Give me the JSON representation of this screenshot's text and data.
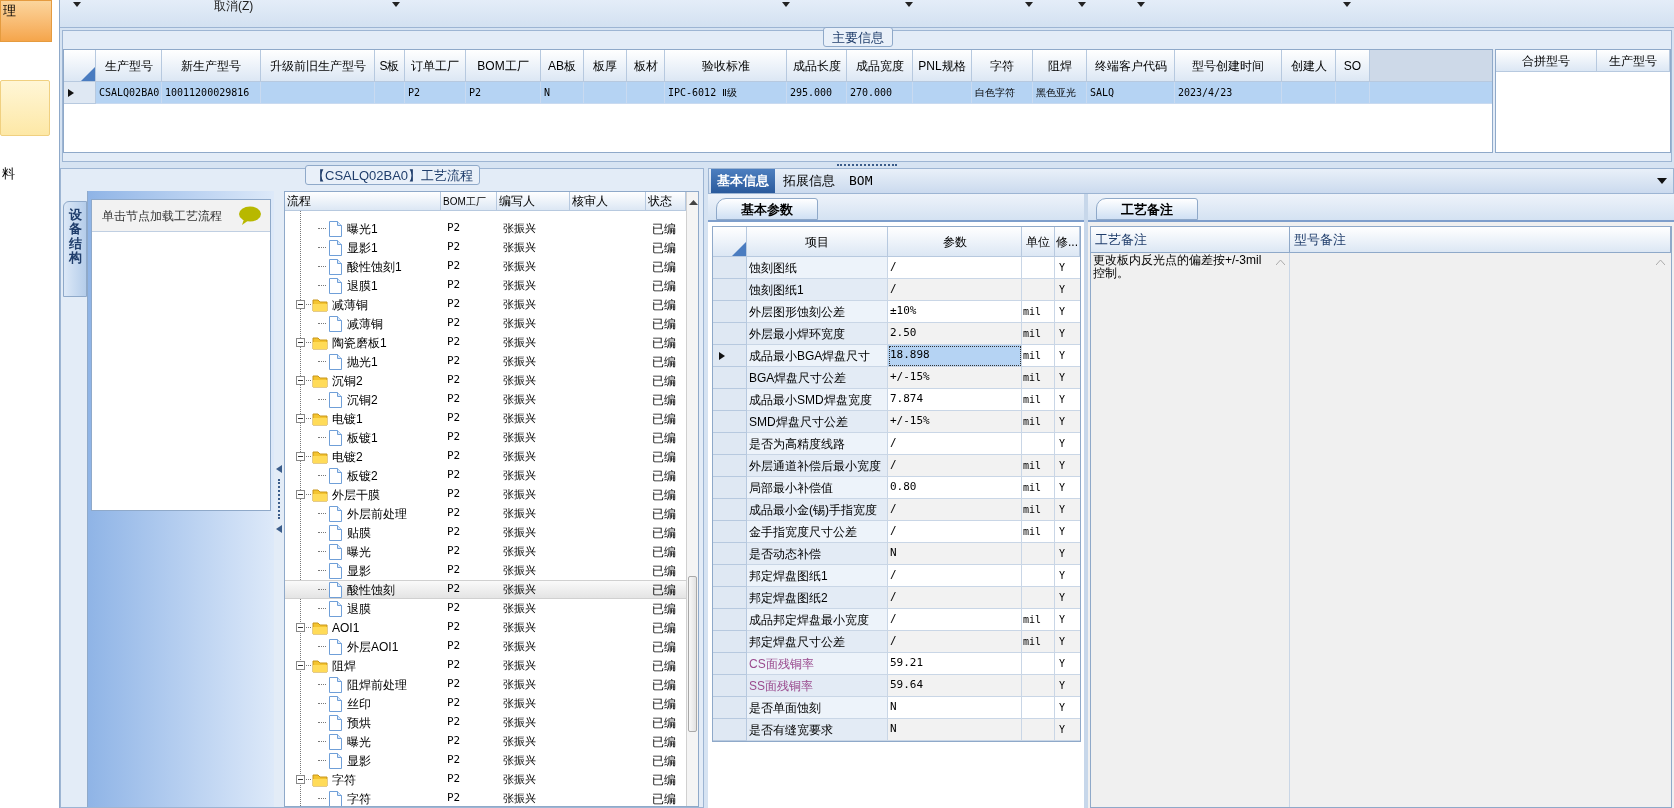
{
  "left_nav": [
    {
      "label": "理",
      "selected": true
    },
    {
      "label": "料",
      "selected": false
    }
  ],
  "toolbar": {
    "label": "取消(Z)"
  },
  "main_info": {
    "title": "主要信息",
    "columns": [
      "生产型号",
      "新生产型号",
      "升级前旧生产型号",
      "S板",
      "订单工厂",
      "BOM工厂",
      "AB板",
      "板厚",
      "板材",
      "验收标准",
      "成品长度",
      "成品宽度",
      "PNL规格",
      "字符",
      "阻焊",
      "终端客户代码",
      "型号创建时间",
      "创建人",
      "SO"
    ],
    "rows": [
      {
        "selected": true,
        "cells": [
          "CSALQ02BA0",
          "10011200029816",
          null,
          null,
          "P2",
          "P2",
          "N",
          null,
          null,
          "IPC-6012 Ⅱ级",
          "295.000",
          "270.000",
          null,
          "白色字符",
          "黑色亚光",
          "SALQ",
          "2023/4/23",
          null,
          null
        ]
      }
    ],
    "merge_columns": [
      "合拼型号",
      "生产型号"
    ]
  },
  "process": {
    "title": "【CSALQ02BA0】工艺流程",
    "side_tab": "设备结构",
    "hint": "单击节点加载工艺流程",
    "columns": [
      "流程",
      "BOM工厂",
      "编写人",
      "核审人",
      "状态"
    ],
    "nodes": [
      {
        "children": [
          {
            "name": "曝光1",
            "bom_factory": "P2",
            "writer": "张振兴",
            "status": "已编",
            "selected": false
          },
          {
            "name": "显影1",
            "bom_factory": "P2",
            "writer": "张振兴",
            "status": "已编",
            "selected": false
          },
          {
            "name": "酸性蚀刻1",
            "bom_factory": "P2",
            "writer": "张振兴",
            "status": "已编",
            "selected": false
          },
          {
            "name": "退膜1",
            "bom_factory": "P2",
            "writer": "张振兴",
            "status": "已编",
            "selected": false
          }
        ]
      },
      {
        "name": "减薄铜",
        "bom_factory": "P2",
        "writer": "张振兴",
        "status": "已编",
        "selected": false,
        "expanded": true,
        "children": [
          {
            "name": "减薄铜",
            "bom_factory": "P2",
            "writer": "张振兴",
            "status": "已编",
            "selected": false
          }
        ]
      },
      {
        "name": "陶瓷磨板1",
        "bom_factory": "P2",
        "writer": "张振兴",
        "status": "已编",
        "selected": false,
        "expanded": true,
        "children": [
          {
            "name": "抛光1",
            "bom_factory": "P2",
            "writer": "张振兴",
            "status": "已编",
            "selected": false
          }
        ]
      },
      {
        "name": "沉铜2",
        "bom_factory": "P2",
        "writer": "张振兴",
        "status": "已编",
        "selected": false,
        "expanded": true,
        "children": [
          {
            "name": "沉铜2",
            "bom_factory": "P2",
            "writer": "张振兴",
            "status": "已编",
            "selected": false
          }
        ]
      },
      {
        "name": "电镀1",
        "bom_factory": "P2",
        "writer": "张振兴",
        "status": "已编",
        "selected": false,
        "expanded": true,
        "children": [
          {
            "name": "板镀1",
            "bom_factory": "P2",
            "writer": "张振兴",
            "status": "已编",
            "selected": false
          }
        ]
      },
      {
        "name": "电镀2",
        "bom_factory": "P2",
        "writer": "张振兴",
        "status": "已编",
        "selected": false,
        "expanded": true,
        "children": [
          {
            "name": "板镀2",
            "bom_factory": "P2",
            "writer": "张振兴",
            "status": "已编",
            "selected": false
          }
        ]
      },
      {
        "name": "外层干膜",
        "bom_factory": "P2",
        "writer": "张振兴",
        "status": "已编",
        "selected": false,
        "expanded": true,
        "children": [
          {
            "name": "外层前处理",
            "bom_factory": "P2",
            "writer": "张振兴",
            "status": "已编",
            "selected": false
          },
          {
            "name": "贴膜",
            "bom_factory": "P2",
            "writer": "张振兴",
            "status": "已编",
            "selected": false
          },
          {
            "name": "曝光",
            "bom_factory": "P2",
            "writer": "张振兴",
            "status": "已编",
            "selected": false
          },
          {
            "name": "显影",
            "bom_factory": "P2",
            "writer": "张振兴",
            "status": "已编",
            "selected": false
          },
          {
            "name": "酸性蚀刻",
            "bom_factory": "P2",
            "writer": "张振兴",
            "status": "已编",
            "selected": true
          },
          {
            "name": "退膜",
            "bom_factory": "P2",
            "writer": "张振兴",
            "status": "已编",
            "selected": false
          }
        ]
      },
      {
        "name": "AOI1",
        "bom_factory": "P2",
        "writer": "张振兴",
        "status": "已编",
        "selected": false,
        "expanded": true,
        "children": [
          {
            "name": "外层AOI1",
            "bom_factory": "P2",
            "writer": "张振兴",
            "status": "已编",
            "selected": false
          }
        ]
      },
      {
        "name": "阻焊",
        "bom_factory": "P2",
        "writer": "张振兴",
        "status": "已编",
        "selected": false,
        "expanded": true,
        "children": [
          {
            "name": "阻焊前处理",
            "bom_factory": "P2",
            "writer": "张振兴",
            "status": "已编",
            "selected": false
          },
          {
            "name": "丝印",
            "bom_factory": "P2",
            "writer": "张振兴",
            "status": "已编",
            "selected": false
          },
          {
            "name": "预烘",
            "bom_factory": "P2",
            "writer": "张振兴",
            "status": "已编",
            "selected": false
          },
          {
            "name": "曝光",
            "bom_factory": "P2",
            "writer": "张振兴",
            "status": "已编",
            "selected": false
          },
          {
            "name": "显影",
            "bom_factory": "P2",
            "writer": "张振兴",
            "status": "已编",
            "selected": false
          }
        ]
      },
      {
        "name": "字符",
        "bom_factory": "P2",
        "writer": "张振兴",
        "status": "已编",
        "selected": false,
        "expanded": true,
        "children": [
          {
            "name": "字符",
            "bom_factory": "P2",
            "writer": "张振兴",
            "status": "已编",
            "selected": false
          }
        ]
      }
    ]
  },
  "detail_tabs": [
    {
      "label": "基本信息",
      "selected": true
    },
    {
      "label": "拓展信息",
      "selected": false
    },
    {
      "label": "BOM",
      "selected": false
    }
  ],
  "params": {
    "tab": "基本参数",
    "columns": [
      "项目",
      "参数",
      "单位",
      "修..."
    ],
    "rows": [
      {
        "item": "蚀刻图纸",
        "value": "/",
        "modified": "Y",
        "kind": "normal",
        "selected": false
      },
      {
        "item": "蚀刻图纸1",
        "value": "/",
        "modified": "Y",
        "kind": "normal",
        "selected": false
      },
      {
        "item": "外层图形蚀刻公差",
        "value": "±10%",
        "unit": "mil",
        "modified": "Y",
        "kind": "normal",
        "selected": false
      },
      {
        "item": "外层最小焊环宽度",
        "value": "2.50",
        "unit": "mil",
        "modified": "Y",
        "kind": "normal",
        "selected": false
      },
      {
        "item": "成品最小BGA焊盘尺寸",
        "value": "18.898",
        "unit": "mil",
        "modified": "Y",
        "kind": "normal",
        "selected": true
      },
      {
        "item": "BGA焊盘尺寸公差",
        "value": "+/-15%",
        "unit": "mil",
        "modified": "Y",
        "kind": "normal",
        "selected": false
      },
      {
        "item": "成品最小SMD焊盘宽度",
        "value": "7.874",
        "unit": "mil",
        "modified": "Y",
        "kind": "normal",
        "selected": false
      },
      {
        "item": "SMD焊盘尺寸公差",
        "value": "+/-15%",
        "unit": "mil",
        "modified": "Y",
        "kind": "normal",
        "selected": false
      },
      {
        "item": "是否为高精度线路",
        "value": "/",
        "modified": "Y",
        "kind": "normal",
        "selected": false
      },
      {
        "item": "外层通道补偿后最小宽度",
        "value": "/",
        "unit": "mil",
        "modified": "Y",
        "kind": "normal",
        "selected": false
      },
      {
        "item": "局部最小补偿值",
        "value": "0.80",
        "unit": "mil",
        "modified": "Y",
        "kind": "normal",
        "selected": false
      },
      {
        "item": "成品最小金(锡)手指宽度",
        "value": "/",
        "unit": "mil",
        "modified": "Y",
        "kind": "normal",
        "selected": false
      },
      {
        "item": "金手指宽度尺寸公差",
        "value": "/",
        "unit": "mil",
        "modified": "Y",
        "kind": "normal",
        "selected": false
      },
      {
        "item": "是否动态补偿",
        "value": "N",
        "modified": "Y",
        "kind": "normal",
        "selected": false
      },
      {
        "item": "邦定焊盘图纸1",
        "value": "/",
        "modified": "Y",
        "kind": "normal",
        "selected": false
      },
      {
        "item": "邦定焊盘图纸2",
        "value": "/",
        "modified": "Y",
        "kind": "normal",
        "selected": false
      },
      {
        "item": "成品邦定焊盘最小宽度",
        "value": "/",
        "unit": "mil",
        "modified": "Y",
        "kind": "normal",
        "selected": false
      },
      {
        "item": "邦定焊盘尺寸公差",
        "value": "/",
        "unit": "mil",
        "modified": "Y",
        "kind": "normal",
        "selected": false
      },
      {
        "item": "CS面残铜率",
        "value": "59.21",
        "modified": "Y",
        "kind": "calculated",
        "selected": false
      },
      {
        "item": "SS面残铜率",
        "value": "59.64",
        "modified": "Y",
        "kind": "calculated",
        "selected": false
      },
      {
        "item": "是否单面蚀刻",
        "value": "N",
        "modified": "Y",
        "kind": "normal",
        "selected": false
      },
      {
        "item": "是否有缝宽要求",
        "value": "N",
        "modified": "Y",
        "kind": "normal",
        "selected": false
      }
    ]
  },
  "notes": {
    "tab": "工艺备注",
    "columns": [
      "工艺备注",
      "型号备注"
    ],
    "process_note": "更改板内反光点的偏差按+/-3mil控制。"
  }
}
